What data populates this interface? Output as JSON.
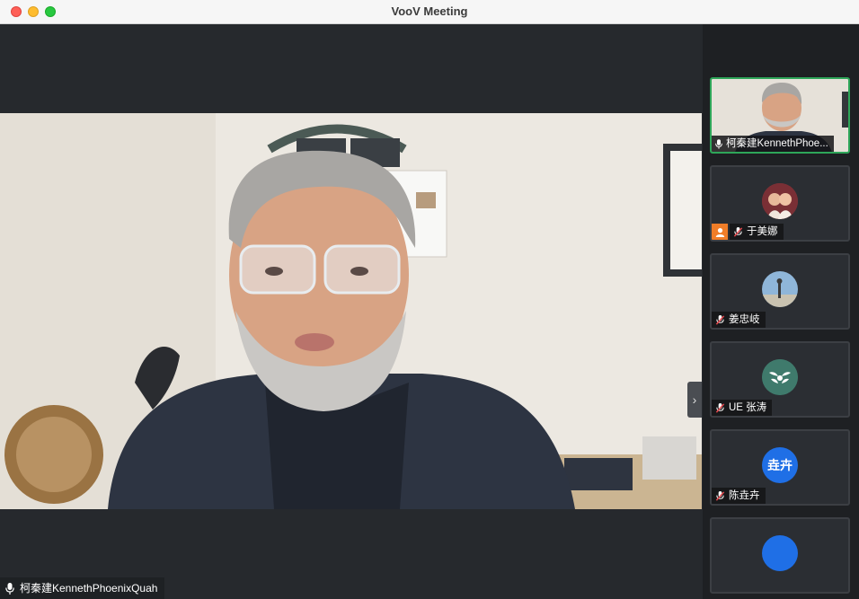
{
  "window": {
    "title": "VooV Meeting"
  },
  "main_video": {
    "speaker_name": "柯秦建KennethPhoenixQuah"
  },
  "participants": [
    {
      "name": "柯秦建KennethPhoe...",
      "mic": "on",
      "avatar": "video"
    },
    {
      "name": "于美娜",
      "mic": "muted",
      "avatar": "photo",
      "host": true
    },
    {
      "name": "姜忠岐",
      "mic": "muted",
      "avatar": "photo"
    },
    {
      "name": "UE 张涛",
      "mic": "muted",
      "avatar": "logo"
    },
    {
      "name": "陈垚卉",
      "mic": "muted",
      "avatar": "initials",
      "initials": "垚卉"
    }
  ],
  "colors": {
    "active_border": "#2ea659",
    "muted_mic": "#e5484d",
    "host_badge": "#f07d28",
    "initials_bg": "#1f6fe6"
  }
}
